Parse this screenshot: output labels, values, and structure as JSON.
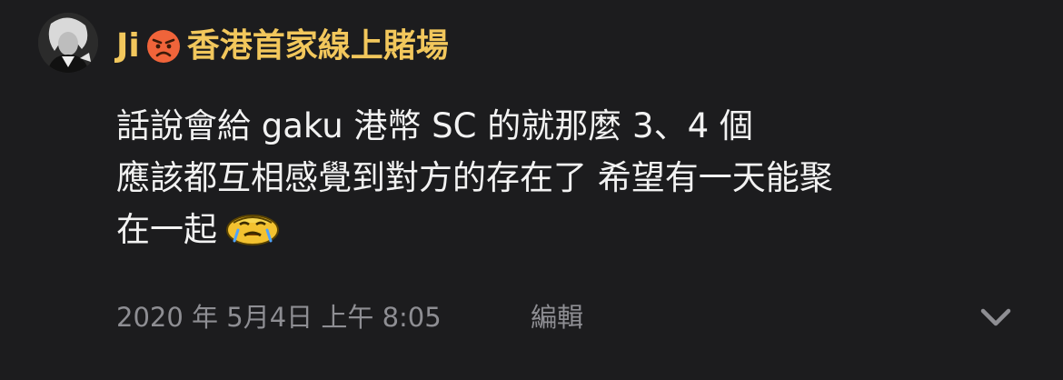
{
  "author": {
    "name": "Ji",
    "emoji_icon": "angry-face-icon",
    "name_suffix": "香港首家線上賭場",
    "name_color": "#f2c75c"
  },
  "comment": {
    "lines": [
      "話說會給 gaku 港幣 SC 的就那麼 3、4 個",
      "應該都互相感覺到對方的存在了 希望有一天能聚",
      "在一起"
    ],
    "trailing_emoticon": "crying-face-icon"
  },
  "meta": {
    "timestamp": "2020 年 5月4日 上午 8:05",
    "edit_label": "編輯",
    "expand_icon": "chevron-down-icon"
  },
  "colors": {
    "background": "#1c1c1e",
    "text": "#f2f2f2",
    "secondary": "#8e8e93"
  }
}
